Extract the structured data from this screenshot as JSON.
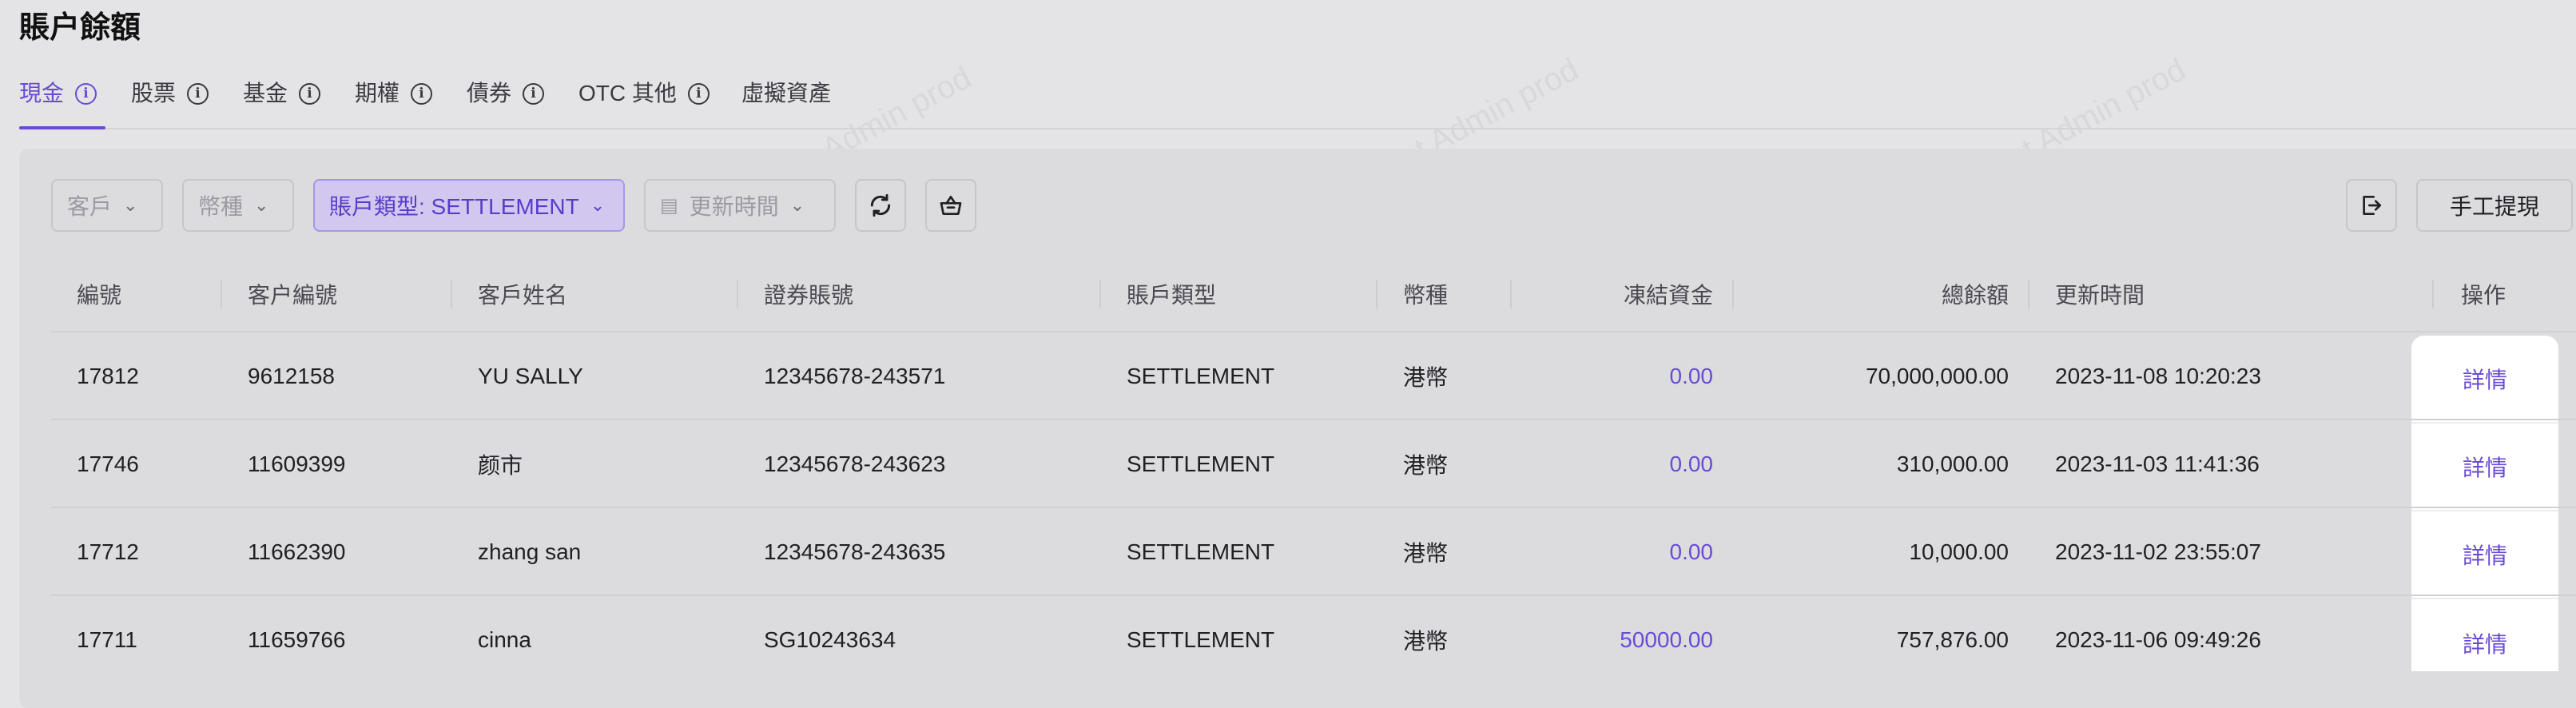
{
  "page": {
    "title": "賬户餘額"
  },
  "tabs": [
    {
      "label": "現金",
      "has_info": true,
      "active": true
    },
    {
      "label": "股票",
      "has_info": true
    },
    {
      "label": "基金",
      "has_info": true
    },
    {
      "label": "期權",
      "has_info": true
    },
    {
      "label": "債券",
      "has_info": true
    },
    {
      "label": "OTC 其他",
      "has_info": true
    },
    {
      "label": "虛擬資產",
      "has_info": false
    }
  ],
  "filters": {
    "customer": "客戶",
    "currency": "幣種",
    "account_type": "賬戶類型: SETTLEMENT",
    "update_time": "更新時間"
  },
  "toolbar": {
    "refresh_icon": "refresh-icon",
    "basket_icon": "basket-icon",
    "export_icon": "export-icon",
    "manual_withdraw_label": "手工提現"
  },
  "table": {
    "columns": [
      "編號",
      "客户編號",
      "客戶姓名",
      "證券賬號",
      "賬戶類型",
      "幣種",
      "凍結資金",
      "總餘額",
      "更新時間",
      "操作"
    ],
    "rows": [
      {
        "id": "17812",
        "customer_no": "9612158",
        "name": "YU SALLY",
        "securities_account": "12345678-243571",
        "account_type": "SETTLEMENT",
        "currency": "港幣",
        "frozen": "0.00",
        "total": "70,000,000.00",
        "updated": "2023-11-08 10:20:23",
        "action": "詳情"
      },
      {
        "id": "17746",
        "customer_no": "11609399",
        "name": "颜市",
        "securities_account": "12345678-243623",
        "account_type": "SETTLEMENT",
        "currency": "港幣",
        "frozen": "0.00",
        "total": "310,000.00",
        "updated": "2023-11-03 11:41:36",
        "action": "詳情"
      },
      {
        "id": "17712",
        "customer_no": "11662390",
        "name": "zhang san",
        "securities_account": "12345678-243635",
        "account_type": "SETTLEMENT",
        "currency": "港幣",
        "frozen": "0.00",
        "total": "10,000.00",
        "updated": "2023-11-02 23:55:07",
        "action": "詳情"
      },
      {
        "id": "17711",
        "customer_no": "11659766",
        "name": "cinna",
        "securities_account": "SG10243634",
        "account_type": "SETTLEMENT",
        "currency": "港幣",
        "frozen": "50000.00",
        "total": "757,876.00",
        "updated": "2023-11-06 09:49:26",
        "action": "詳情"
      }
    ]
  },
  "watermark": "LongPort Test Admin prod",
  "colors": {
    "accent": "#6a4bd4",
    "background": "#e4e4e6"
  }
}
